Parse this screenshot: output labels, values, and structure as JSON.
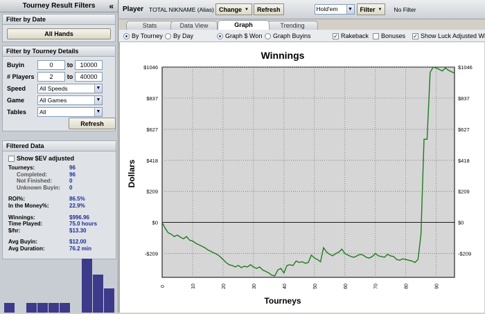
{
  "sidebar": {
    "title": "Tourney Result Filters",
    "collapse_glyph": "«",
    "filter_by_date": {
      "header": "Filter by Date",
      "button": "All Hands"
    },
    "filter_by_tourney": {
      "header": "Filter by Tourney Details",
      "buyin": {
        "label": "Buyin",
        "min": "0",
        "to": "to",
        "max": "10000"
      },
      "players": {
        "label": "# Players",
        "min": "2",
        "to": "to",
        "max": "40000"
      },
      "speed": {
        "label": "Speed",
        "value": "All Speeds"
      },
      "game": {
        "label": "Game",
        "value": "All Games"
      },
      "tables": {
        "label": "Tables",
        "value": "All"
      },
      "refresh": "Refresh"
    },
    "filtered": {
      "header": "Filtered Data",
      "ev_label": "Show $EV adjusted",
      "rows": [
        {
          "k": "Tourneys:",
          "v": "96",
          "sub": false
        },
        {
          "k": "Completed:",
          "v": "96",
          "sub": true
        },
        {
          "k": "Not Finished:",
          "v": "0",
          "sub": true
        },
        {
          "k": "Unknown Buyin:",
          "v": "0",
          "sub": true
        },
        {
          "gap": true
        },
        {
          "k": "ROI%:",
          "v": "86.5%",
          "sub": false
        },
        {
          "k": "In the Money%:",
          "v": "22.9%",
          "sub": false
        },
        {
          "gap": true
        },
        {
          "k": "Winnings:",
          "v": "$996.96",
          "sub": false
        },
        {
          "k": "Time Played:",
          "v": "75.0 hours",
          "sub": false
        },
        {
          "k": "$/hr:",
          "v": "$13.30",
          "sub": false
        },
        {
          "gap": true
        },
        {
          "k": "Avg Buyin:",
          "v": "$12.00",
          "sub": false
        },
        {
          "k": "Avg Duration:",
          "v": "76.2 min",
          "sub": false
        }
      ]
    },
    "histogram": [
      0.18,
      0,
      0.18,
      0.18,
      0.18,
      0.18,
      0,
      1.0,
      0.7,
      0.45
    ]
  },
  "topbar": {
    "player_label": "Player",
    "player_name": "TOTAL NIKNAME (Alias)",
    "change": "Change",
    "refresh": "Refresh",
    "game": "Hold'em",
    "filter": "Filter",
    "filter_status": "No Filter"
  },
  "tabs": [
    "Stats",
    "Data View",
    "Graph",
    "Trending"
  ],
  "active_tab": "Graph",
  "options": {
    "by_tourney": "By Tourney",
    "by_day": "By Day",
    "graph_won": "Graph $ Won",
    "graph_buyins": "Graph Buyins",
    "rakeback": "Rakeback",
    "bonuses": "Bonuses",
    "luck": "Show Luck Adjusted Win"
  },
  "colors": {
    "line": "#1e7a1e",
    "plot_bg": "#d6d6d6",
    "sidebar_values": "#1a2e9a"
  },
  "chart_data": {
    "type": "line",
    "title": "Winnings",
    "xlabel": "Tourneys",
    "ylabel": "Dollars",
    "xlim": [
      0,
      96
    ],
    "ylim": [
      -370,
      1046
    ],
    "yticks": [
      "-$209",
      "$0",
      "$209",
      "$418",
      "$627",
      "$837",
      "$1046"
    ],
    "ytick_values": [
      -209,
      0,
      209,
      418,
      627,
      837,
      1046
    ],
    "xticks": [
      0,
      10,
      20,
      30,
      40,
      50,
      60,
      70,
      80,
      90
    ],
    "grid": true,
    "series": [
      {
        "x": [
          0,
          1,
          2,
          3,
          4,
          5,
          6,
          7,
          8,
          9,
          10,
          11,
          12,
          13,
          14,
          15,
          16,
          17,
          18,
          19,
          20,
          21,
          22,
          23,
          24,
          25,
          26,
          27,
          28,
          29,
          30,
          31,
          32,
          33,
          34,
          35,
          36,
          37,
          38,
          39,
          40,
          41,
          42,
          43,
          44,
          45,
          46,
          47,
          48,
          49,
          50,
          51,
          52,
          53,
          54,
          55,
          56,
          57,
          58,
          59,
          60,
          61,
          62,
          63,
          64,
          65,
          66,
          67,
          68,
          69,
          70,
          71,
          72,
          73,
          74,
          75,
          76,
          77,
          78,
          79,
          80,
          81,
          82,
          83,
          84,
          85,
          86,
          87,
          88,
          89,
          90,
          91,
          92,
          93,
          94,
          95,
          96
        ],
        "y": [
          0,
          -40,
          -70,
          -80,
          -95,
          -85,
          -100,
          -110,
          -95,
          -120,
          -125,
          -140,
          -150,
          -160,
          -170,
          -185,
          -195,
          -205,
          -215,
          -230,
          -250,
          -270,
          -285,
          -290,
          -300,
          -290,
          -305,
          -295,
          -300,
          -285,
          -300,
          -310,
          -300,
          -320,
          -330,
          -340,
          -355,
          -360,
          -320,
          -310,
          -340,
          -290,
          -285,
          -290,
          -260,
          -270,
          -265,
          -275,
          -270,
          -220,
          -240,
          -250,
          -265,
          -170,
          -200,
          -215,
          -225,
          -210,
          -200,
          -180,
          -210,
          -220,
          -230,
          -235,
          -225,
          -215,
          -220,
          -235,
          -240,
          -230,
          -210,
          -225,
          -230,
          -235,
          -215,
          -225,
          -230,
          -250,
          -255,
          -245,
          -250,
          -255,
          -260,
          -270,
          -250,
          -80,
          560,
          560,
          1010,
          1046,
          1040,
          1030,
          1020,
          1040,
          1025,
          1015,
          1005
        ]
      }
    ]
  }
}
